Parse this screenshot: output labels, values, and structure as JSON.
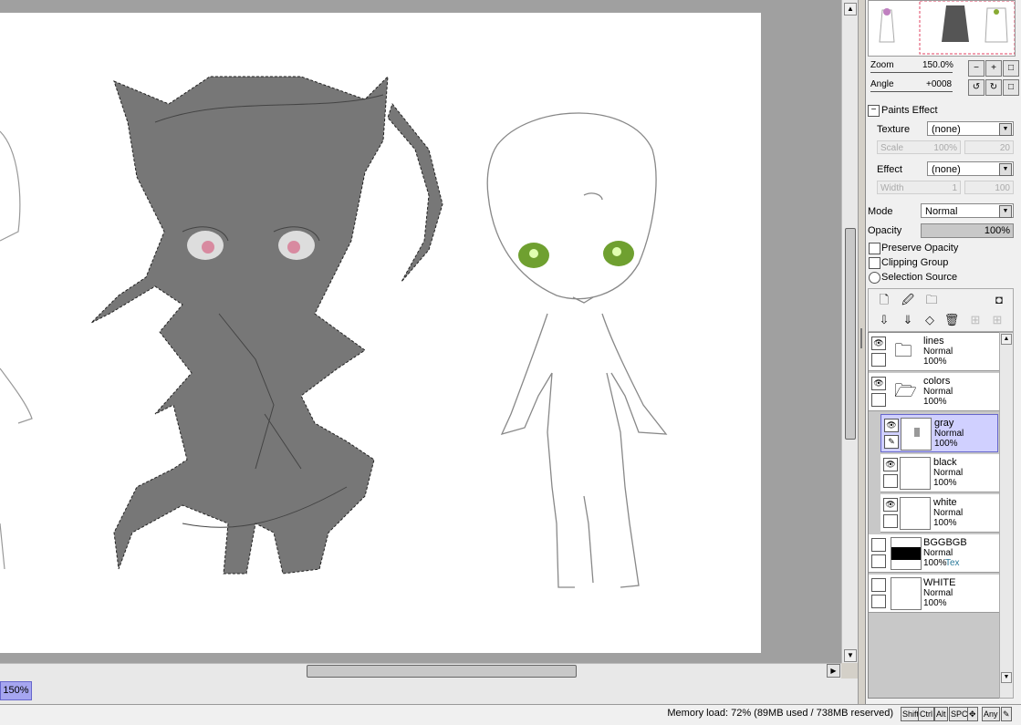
{
  "canvas": {
    "zoom_badge": "150%"
  },
  "navigator": {
    "zoom_label": "Zoom",
    "zoom_value": "150.0%",
    "angle_label": "Angle",
    "angle_value": "+0008"
  },
  "paints_effect": {
    "title": "Paints Effect",
    "texture_label": "Texture",
    "texture_value": "(none)",
    "scale_label": "Scale",
    "scale_value": "100%",
    "scale_right": "20",
    "effect_label": "Effect",
    "effect_value": "(none)",
    "width_label": "Width",
    "width_value": "1",
    "width_right": "100"
  },
  "layer_props": {
    "mode_label": "Mode",
    "mode_value": "Normal",
    "opacity_label": "Opacity",
    "opacity_value": "100%",
    "preserve_opacity": "Preserve Opacity",
    "clipping_group": "Clipping Group",
    "selection_source": "Selection Source"
  },
  "layers": [
    {
      "name": "lines",
      "mode": "Normal",
      "opacity": "100%",
      "type": "folder"
    },
    {
      "name": "colors",
      "mode": "Normal",
      "opacity": "100%",
      "type": "folder"
    },
    {
      "name": "gray",
      "mode": "Normal",
      "opacity": "100%",
      "type": "layer"
    },
    {
      "name": "black",
      "mode": "Normal",
      "opacity": "100%",
      "type": "layer"
    },
    {
      "name": "white",
      "mode": "Normal",
      "opacity": "100%",
      "type": "layer"
    },
    {
      "name": "BGGBGB",
      "mode": "Normal",
      "opacity": "100%",
      "extra": "Tex",
      "type": "layer"
    },
    {
      "name": "WHITE",
      "mode": "Normal",
      "opacity": "100%",
      "type": "layer"
    }
  ],
  "status": {
    "memory": "Memory load: 72% (89MB used / 738MB reserved)",
    "keys": [
      "Shift",
      "Ctrl",
      "Alt",
      "SPC",
      "Any"
    ]
  },
  "colors": {
    "selection": "#d0d0ff",
    "accent_border": "#6666cc"
  }
}
